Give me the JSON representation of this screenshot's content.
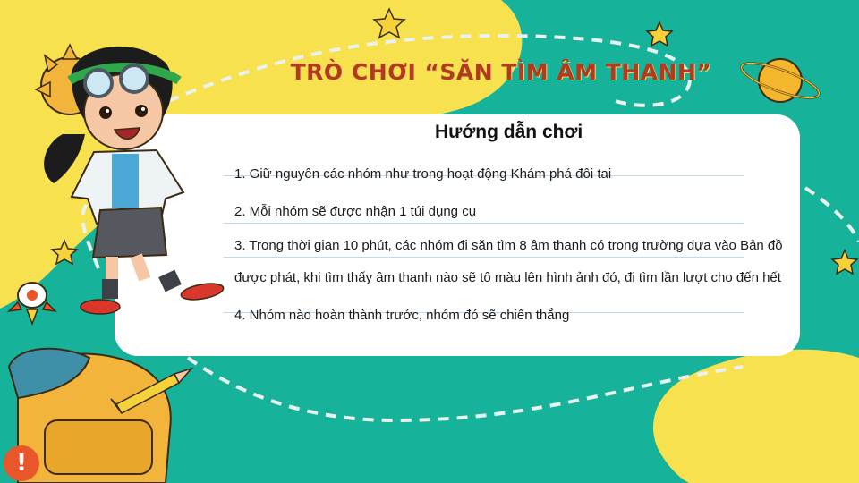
{
  "slide": {
    "title": "TRÒ CHƠI “SĂN TÌM ÂM THANH”",
    "card": {
      "heading": "Hướng dẫn chơi",
      "steps": [
        "1. Giữ nguyên các nhóm như trong hoạt động Khám phá đôi tai",
        "2. Mỗi nhóm sẽ được nhận 1 túi dụng cụ",
        "3. Trong thời gian 10 phút, các nhóm đi săn tìm 8 âm thanh có trong trường dựa vào Bản đồ",
        "được phát, khi tìm thấy âm thanh nào sẽ tô màu lên hình ảnh đó, đi tìm lần lượt cho đến hết",
        "4. Nhóm nào hoàn thành trước, nhóm đó sẽ chiến thắng"
      ]
    },
    "alert_icon": "!"
  },
  "colors": {
    "teal_background": "#17b29a",
    "yellow_blob": "#f7e14e",
    "title_red": "#b23a1f",
    "card_white": "#ffffff"
  },
  "icons": [
    "star-icon",
    "planet-icon",
    "rocket-icon",
    "pencil-icon",
    "backpack-icon",
    "kid-scientist-illustration",
    "alert-icon"
  ]
}
